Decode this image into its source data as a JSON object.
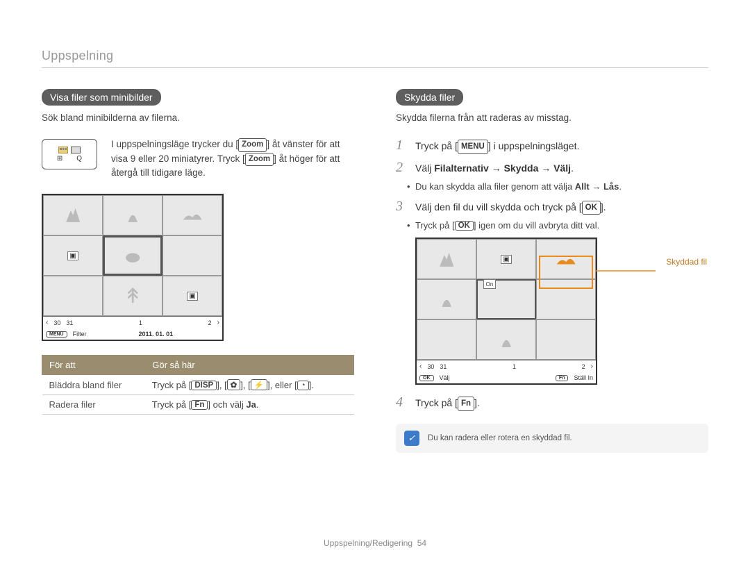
{
  "header": {
    "title": "Uppspelning"
  },
  "left": {
    "pill": "Visa filer som minibilder",
    "intro": "Sök bland minibilderna av filerna.",
    "thumb_tip_a": "I uppspelningsläge trycker du [",
    "thumb_tip_zoom": "Zoom",
    "thumb_tip_b": "] åt vänster för att visa 9 eller 20 miniatyrer. Tryck [",
    "thumb_tip_c": "] åt höger för att återgå till tidigare läge.",
    "shot_bar": {
      "n1": "30",
      "n2": "31",
      "n3": "1",
      "n4": "2"
    },
    "shot_bar2": {
      "menu": "MENU",
      "filter": "Filter",
      "date": "2011. 01. 01"
    },
    "table": {
      "h1": "För att",
      "h2": "Gör så här",
      "r1c1": "Bläddra bland filer",
      "r1c2_a": "Tryck på [",
      "r1c2_b": "], [",
      "r1c2_c": "], [",
      "r1c2_d": "], eller [",
      "r1c2_e": "].",
      "r1_disp": "DISP",
      "r2c1": "Radera filer",
      "r2c2_a": "Tryck på [",
      "r2c2_fn": "Fn",
      "r2c2_b": "] och välj ",
      "r2c2_ja": "Ja",
      "r2c2_c": "."
    }
  },
  "right": {
    "pill": "Skydda filer",
    "intro": "Skydda filerna från att raderas av misstag.",
    "step1_a": "Tryck på [",
    "step1_menu": "MENU",
    "step1_b": "] i uppspelningsläget.",
    "step2_a": "Välj ",
    "step2_b": "Filalternativ → Skydda → Välj",
    "step2_c": ".",
    "step2_sub_a": "Du kan skydda alla filer genom att välja ",
    "step2_sub_b": "Allt → Lås",
    "step2_sub_c": ".",
    "step3_a": "Välj den fil du vill skydda och tryck på [",
    "step3_ok": "OK",
    "step3_b": "].",
    "step3_sub_a": "Tryck på [",
    "step3_sub_b": "] igen om du vill avbryta ditt val.",
    "shot2_bar": {
      "n1": "30",
      "n2": "31",
      "n3": "1",
      "n4": "2"
    },
    "shot2_bar2": {
      "ok": "OK",
      "valj": "Välj",
      "fn": "Fn",
      "stall": "Ställ In"
    },
    "callout": "Skyddad fil",
    "lock_label": "On",
    "step4_a": "Tryck på [",
    "step4_fn": "Fn",
    "step4_b": "].",
    "note": "Du kan radera eller rotera en skyddad fil."
  },
  "footer": {
    "text": "Uppspelning/Redigering",
    "page": "54"
  },
  "icons": {
    "flower": "✿",
    "flash": "⚡",
    "timer": "◔"
  }
}
